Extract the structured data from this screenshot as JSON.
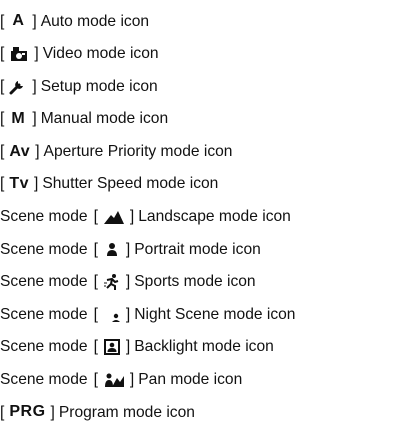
{
  "open_bracket": "[",
  "close_bracket": "]",
  "rows": [
    {
      "prefix": "",
      "icon": "auto-mode-icon",
      "icon_text": "A",
      "label": "Auto mode icon"
    },
    {
      "prefix": "",
      "icon": "video-mode-icon",
      "icon_text": "",
      "label": "Video mode icon"
    },
    {
      "prefix": "",
      "icon": "setup-mode-icon",
      "icon_text": "",
      "label": "Setup mode icon"
    },
    {
      "prefix": "",
      "icon": "manual-mode-icon",
      "icon_text": "M",
      "label": "Manual mode icon"
    },
    {
      "prefix": "",
      "icon": "aperture-priority-mode-icon",
      "icon_text": "Av",
      "label": "Aperture Priority mode icon"
    },
    {
      "prefix": "",
      "icon": "shutter-speed-mode-icon",
      "icon_text": "Tv",
      "label": "Shutter Speed mode icon"
    },
    {
      "prefix": "Scene mode",
      "icon": "landscape-mode-icon",
      "icon_text": "",
      "label": "Landscape mode icon"
    },
    {
      "prefix": "Scene mode",
      "icon": "portrait-mode-icon",
      "icon_text": "",
      "label": "Portrait mode icon"
    },
    {
      "prefix": "Scene mode",
      "icon": "sports-mode-icon",
      "icon_text": "",
      "label": "Sports mode icon"
    },
    {
      "prefix": "Scene mode",
      "icon": "night-scene-mode-icon",
      "icon_text": "",
      "label": "Night Scene mode icon"
    },
    {
      "prefix": "Scene mode",
      "icon": "backlight-mode-icon",
      "icon_text": "",
      "label": "Backlight mode icon"
    },
    {
      "prefix": "Scene mode",
      "icon": "pan-mode-icon",
      "icon_text": "",
      "label": "Pan mode icon"
    },
    {
      "prefix": "",
      "icon": "program-mode-icon",
      "icon_text": "PRG",
      "label": "Program mode icon"
    }
  ]
}
